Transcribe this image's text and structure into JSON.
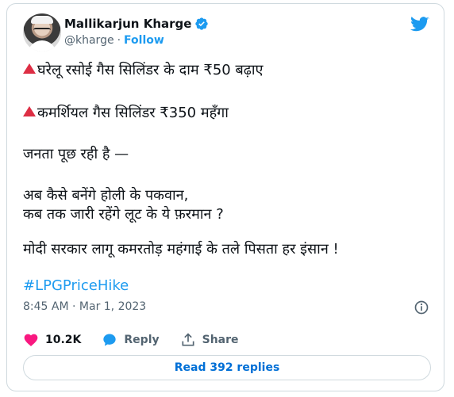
{
  "author": {
    "name": "Mallikarjun Kharge",
    "handle": "@kharge",
    "separator": "·",
    "follow_label": "Follow"
  },
  "tweet": {
    "lines": [
      "घरेलू रसोई गैस सिलिंडर के दाम ₹50 बढ़ाए",
      "कमर्शियल गैस सिलिंडर ₹350 महँगा",
      "जनता पूछ रही है —",
      "अब कैसे बनेंगे होली के पकवान,",
      "कब तक जारी रहेंगे लूट के ये फ़रमान ?",
      "मोदी सरकार लागू कमरतोड़ महंगाई के तले पिसता हर इंसान !"
    ],
    "hashtag": "#LPGPriceHike",
    "time": "8:45 AM",
    "date_separator": "·",
    "date": "Mar 1, 2023"
  },
  "actions": {
    "likes": "10.2K",
    "reply_label": "Reply",
    "share_label": "Share"
  },
  "read_replies_label": "Read 392 replies",
  "colors": {
    "accent": "#1d9bf0",
    "like": "#f91880",
    "bullet": "#dd2e44"
  },
  "icons": [
    "twitter-bird-icon",
    "verified-badge-icon",
    "info-icon",
    "heart-icon",
    "reply-bubble-icon",
    "share-icon",
    "red-triangle-icon"
  ]
}
